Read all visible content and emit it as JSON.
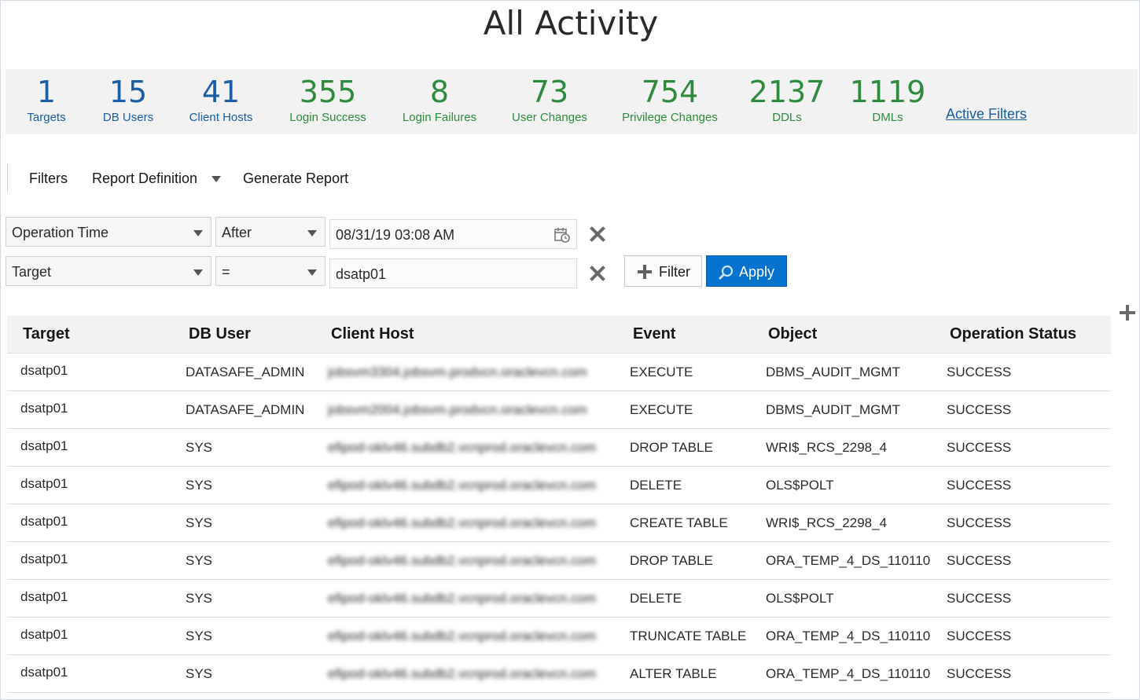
{
  "title": "All Activity",
  "summary": {
    "stats": [
      {
        "value": "1",
        "label": "Targets",
        "color": "#1b5ea4"
      },
      {
        "value": "15",
        "label": "DB Users",
        "color": "#1b5ea4"
      },
      {
        "value": "41",
        "label": "Client Hosts",
        "color": "#1b5ea4"
      },
      {
        "value": "355",
        "label": "Login Success",
        "color": "#2e8b3d"
      },
      {
        "value": "8",
        "label": "Login Failures",
        "color": "#2e8b3d"
      },
      {
        "value": "73",
        "label": "User Changes",
        "color": "#2e8b3d"
      },
      {
        "value": "754",
        "label": "Privilege Changes",
        "color": "#2e8b3d"
      },
      {
        "value": "2137",
        "label": "DDLs",
        "color": "#2e8b3d"
      },
      {
        "value": "1119",
        "label": "DMLs",
        "color": "#2e8b3d"
      }
    ],
    "active_filters_link": "Active Filters"
  },
  "toolbar": {
    "filters": "Filters",
    "report_definition": "Report Definition",
    "generate_report": "Generate Report"
  },
  "filters": [
    {
      "field": "Operation Time",
      "operator": "After",
      "value": "08/31/19 03:08 AM"
    },
    {
      "field": "Target",
      "operator": "=",
      "value": "dsatp01"
    }
  ],
  "buttons": {
    "add_filter": "Filter",
    "apply": "Apply",
    "apply_color": "#0572ce"
  },
  "table": {
    "columns": [
      "Target",
      "DB User",
      "Client Host",
      "Event",
      "Object",
      "Operation Status"
    ],
    "rows": [
      [
        "dsatp01",
        "DATASAFE_ADMIN",
        "jobsvm3304.jobsvm.prodvcn.oraclevcn.com",
        "EXECUTE",
        "DBMS_AUDIT_MGMT",
        "SUCCESS"
      ],
      [
        "dsatp01",
        "DATASAFE_ADMIN",
        "jobsvm2004.jobsvm.prodvcn.oraclevcn.com",
        "EXECUTE",
        "DBMS_AUDIT_MGMT",
        "SUCCESS"
      ],
      [
        "dsatp01",
        "SYS",
        "efipod-oklv46.subdb2.vcnprod.oraclevcn.com",
        "DROP TABLE",
        "WRI$_RCS_2298_4",
        "SUCCESS"
      ],
      [
        "dsatp01",
        "SYS",
        "efipod-oklv46.subdb2.vcnprod.oraclevcn.com",
        "DELETE",
        "OLS$POLT",
        "SUCCESS"
      ],
      [
        "dsatp01",
        "SYS",
        "efipod-oklv46.subdb2.vcnprod.oraclevcn.com",
        "CREATE TABLE",
        "WRI$_RCS_2298_4",
        "SUCCESS"
      ],
      [
        "dsatp01",
        "SYS",
        "efipod-oklv46.subdb2.vcnprod.oraclevcn.com",
        "DROP TABLE",
        "ORA_TEMP_4_DS_110110",
        "SUCCESS"
      ],
      [
        "dsatp01",
        "SYS",
        "efipod-oklv46.subdb2.vcnprod.oraclevcn.com",
        "DELETE",
        "OLS$POLT",
        "SUCCESS"
      ],
      [
        "dsatp01",
        "SYS",
        "efipod-oklv46.subdb2.vcnprod.oraclevcn.com",
        "TRUNCATE TABLE",
        "ORA_TEMP_4_DS_110110",
        "SUCCESS"
      ],
      [
        "dsatp01",
        "SYS",
        "efipod-oklv46.subdb2.vcnprod.oraclevcn.com",
        "ALTER TABLE",
        "ORA_TEMP_4_DS_110110",
        "SUCCESS"
      ]
    ]
  }
}
